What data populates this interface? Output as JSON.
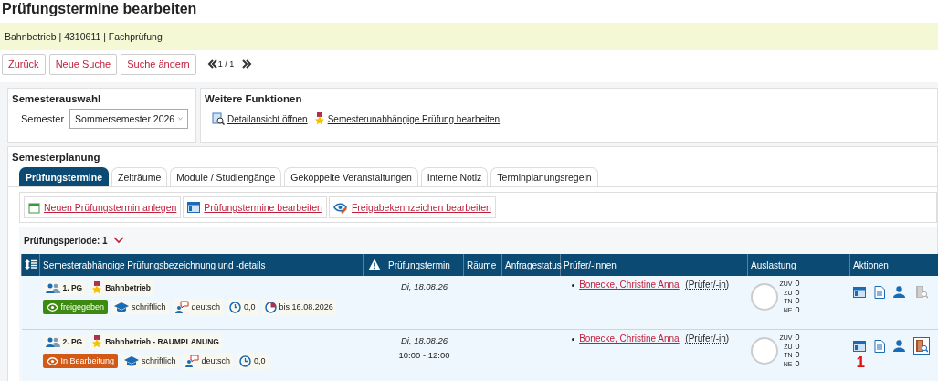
{
  "page_title": "Prüfungstermine bearbeiten",
  "context_bar": "Bahnbetrieb | 4310611 | Fachprüfung",
  "nav_buttons": [
    "Zurück",
    "Neue Suche",
    "Suche ändern"
  ],
  "pager": "1 / 1",
  "semester_panel": {
    "title": "Semesterauswahl",
    "label": "Semester",
    "value": "Sommersemester 2026"
  },
  "functions_panel": {
    "title": "Weitere Funktionen",
    "links": [
      {
        "kind": "detail",
        "label": "Detailansicht öffnen"
      },
      {
        "kind": "medal",
        "label": "Semesterunabhängige Prüfung bearbeiten"
      }
    ]
  },
  "planning": {
    "title": "Semesterplanung",
    "tabs": [
      {
        "label": "Prüfungstermine",
        "selected": true
      },
      {
        "label": "Zeiträume",
        "selected": false
      },
      {
        "label": "Module / Studiengänge",
        "selected": false
      },
      {
        "label": "Gekoppelte Veranstaltungen",
        "selected": false
      },
      {
        "label": "Interne Notiz",
        "selected": false
      },
      {
        "label": "Terminplanungsregeln",
        "selected": false
      }
    ],
    "actions": [
      {
        "kind": "calendar",
        "label": "Neuen Prüfungstermin anlegen"
      },
      {
        "kind": "table",
        "label": "Prüfungstermine bearbeiten"
      },
      {
        "kind": "eye",
        "label": "Freigabekennzeichen bearbeiten"
      }
    ],
    "period": {
      "label": "Prüfungsperiode: 1",
      "expanded": true
    },
    "table": {
      "columns": [
        "Semesterabhängige Prüfungsbezeichnung und -details",
        "Prüfungstermin",
        "Räume",
        "Anfragestatus",
        "Prüfer/-innen",
        "Auslastung",
        "Aktionen"
      ],
      "rows": [
        {
          "group": "1. PG",
          "name": "Bahnbetrieb",
          "status": {
            "label": "freigegeben",
            "kind": "released"
          },
          "form": "schriftlich",
          "language": "deutsch",
          "credits": "0,0",
          "deadline": "bis 16.08.2026",
          "date": "Di, 18.08.26",
          "time": null,
          "examiner": "Bonecke, Christine Anna",
          "role": "(Prüfer/-in)",
          "load": [
            {
              "label": "ZUV",
              "value": "0"
            },
            {
              "label": "ZU",
              "value": "0"
            },
            {
              "label": "TN",
              "value": "0"
            },
            {
              "label": "NE",
              "value": "0"
            }
          ],
          "room_action": {
            "disabled": true,
            "highlighted": false
          },
          "marker": null
        },
        {
          "group": "2. PG",
          "name": "Bahnbetrieb - RAUMPLANUNG",
          "status": {
            "label": "In Bearbeitung",
            "kind": "editing"
          },
          "form": "schriftlich",
          "language": "deutsch",
          "credits": "0,0",
          "deadline": null,
          "date": "Di, 18.08.26",
          "time": "10:00 - 12:00",
          "examiner": "Bonecke, Christine Anna",
          "role": "(Prüfer/-in)",
          "load": [
            {
              "label": "ZUV",
              "value": "0"
            },
            {
              "label": "ZU",
              "value": "0"
            },
            {
              "label": "TN",
              "value": "0"
            },
            {
              "label": "NE",
              "value": "0"
            }
          ],
          "room_action": {
            "disabled": false,
            "highlighted": true
          },
          "marker": "1"
        }
      ]
    }
  }
}
